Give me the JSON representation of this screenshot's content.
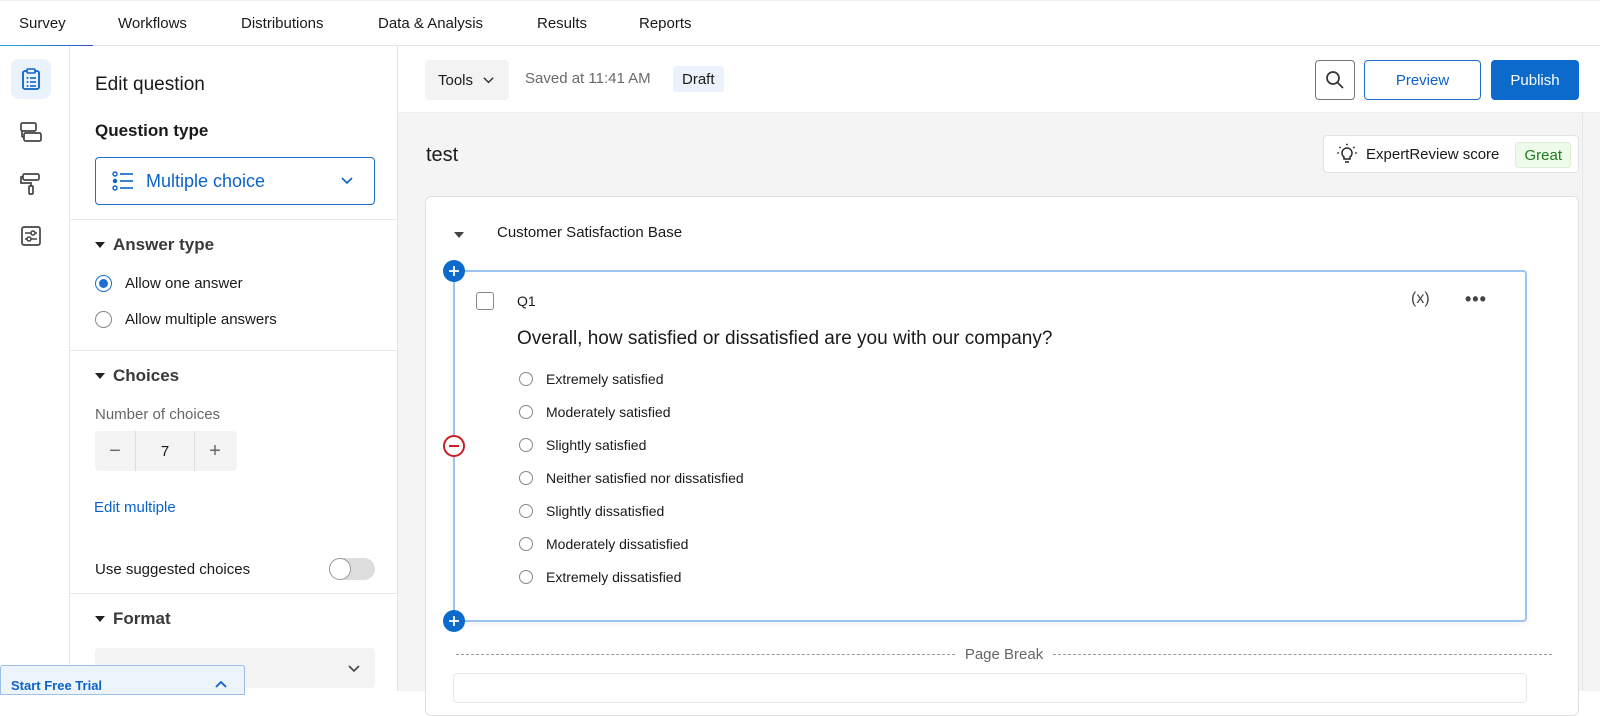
{
  "topnav": {
    "tabs": [
      {
        "label": "Survey",
        "active": true
      },
      {
        "label": "Workflows"
      },
      {
        "label": "Distributions"
      },
      {
        "label": "Data & Analysis"
      },
      {
        "label": "Results"
      },
      {
        "label": "Reports"
      }
    ]
  },
  "rail": {
    "items": [
      {
        "icon": "survey-clipboard-icon",
        "active": true
      },
      {
        "icon": "survey-flow-icon"
      },
      {
        "icon": "look-and-feel-paint-roller-icon"
      },
      {
        "icon": "survey-options-sliders-icon"
      }
    ]
  },
  "panel": {
    "title": "Edit question",
    "question_type_label": "Question type",
    "question_type_value": "Multiple choice",
    "answer_type": {
      "heading": "Answer type",
      "options": [
        {
          "label": "Allow one answer",
          "selected": true
        },
        {
          "label": "Allow multiple answers",
          "selected": false
        }
      ]
    },
    "choices": {
      "heading": "Choices",
      "number_label": "Number of choices",
      "number_value": "7",
      "decrement": "−",
      "increment": "+",
      "edit_multiple": "Edit multiple",
      "suggested_label": "Use suggested choices",
      "suggested_on": false
    },
    "format": {
      "heading": "Format"
    }
  },
  "trial": {
    "label": "Start Free Trial"
  },
  "toolbar": {
    "tools_label": "Tools",
    "saved_text": "Saved at 11:41 AM",
    "status_badge": "Draft",
    "preview_label": "Preview",
    "publish_label": "Publish"
  },
  "survey": {
    "title": "test",
    "expert_review_label": "ExpertReview score",
    "expert_review_score": "Great",
    "block_name": "Customer Satisfaction Base",
    "question": {
      "number": "Q1",
      "piped_text": "(x)",
      "more": "•••",
      "text": "Overall, how satisfied or dissatisfied are you with our company?",
      "choices": [
        "Extremely satisfied",
        "Moderately satisfied",
        "Slightly satisfied",
        "Neither satisfied nor dissatisfied",
        "Slightly dissatisfied",
        "Moderately dissatisfied",
        "Extremely dissatisfied"
      ]
    },
    "page_break_label": "Page Break"
  },
  "colors": {
    "accent": "#0b6acb",
    "accent_text": "#0b63c9",
    "danger": "#c81f25",
    "success_text": "#1d7a1d",
    "question_border": "#9cc4ee"
  }
}
